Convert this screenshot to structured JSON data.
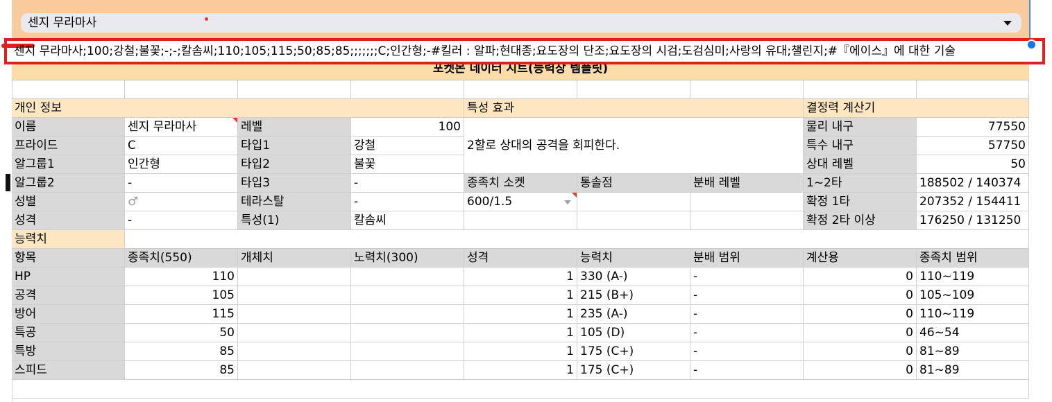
{
  "dropdown": {
    "value": "센지 무라마사"
  },
  "formula_cell": {
    "text": "센지 무라마사;100;강철;불꽃;-;-;칼솜씨;110;105;115;50;85;85;;;;;;;C;인간형;-#킬러 : 알파;현대종;요도장의 단조;요도장의 시검;도검심미;사랑의 유대;챌린지;#『에이스』에 대한 기술"
  },
  "title": "포켓몬 데이터 시트(능력창 템플릿)",
  "sections": {
    "personal": "개인 정보",
    "trait": "특성 효과",
    "calc": "결정력 계산기",
    "stats": "능력치"
  },
  "personal": {
    "name_label": "이름",
    "name": "센지 무라마사",
    "level_label": "레벨",
    "level": "100",
    "pride_label": "프라이드",
    "pride": "C",
    "type1_label": "타입1",
    "type1": "강철",
    "egg1_label": "알그룹1",
    "egg1": "인간형",
    "type2_label": "타입2",
    "type2": "불꽃",
    "egg2_label": "알그룹2",
    "egg2": "-",
    "type3_label": "타입3",
    "type3": "-",
    "gender_label": "성별",
    "gender": "♂",
    "tera_label": "테라스탈",
    "tera": "-",
    "nature_label": "성격",
    "nature": "-",
    "ability_label": "특성(1)",
    "ability": "칼솜씨"
  },
  "trait_effect": "2할로 상대의 공격을 회피한다.",
  "socket": {
    "socket_label": "종족치 소켓",
    "socket_value": "600/1.5",
    "command_label": "통솔점",
    "dist_level_label": "분배 레벨"
  },
  "calc": {
    "phys_label": "물리 내구",
    "phys": "77550",
    "spec_label": "특수 내구",
    "spec": "57750",
    "opp_level_label": "상대 레벨",
    "opp_level": "50",
    "hit12_label": "1~2타",
    "hit12": "188502 / 140374",
    "ko1_label": "확정 1타",
    "ko1": "207352 / 154411",
    "ko2_label": "확정 2타 이상",
    "ko2": "176250 / 131250"
  },
  "stats_headers": [
    "항목",
    "종족치(550)",
    "개체치",
    "노력치(300)",
    "성격",
    "능력치",
    "분배 범위",
    "계산용",
    "종족치 범위"
  ],
  "stats_rows": [
    {
      "name": "HP",
      "base": "110",
      "iv": "",
      "ev": "",
      "nature": "1",
      "stat": "330 (A-)",
      "dist": "-",
      "calc": "0",
      "range": "110~119"
    },
    {
      "name": "공격",
      "base": "105",
      "iv": "",
      "ev": "",
      "nature": "1",
      "stat": "215 (B+)",
      "dist": "-",
      "calc": "0",
      "range": "105~109"
    },
    {
      "name": "방어",
      "base": "115",
      "iv": "",
      "ev": "",
      "nature": "1",
      "stat": "235 (A-)",
      "dist": "-",
      "calc": "0",
      "range": "110~119"
    },
    {
      "name": "특공",
      "base": "50",
      "iv": "",
      "ev": "",
      "nature": "1",
      "stat": "105 (D)",
      "dist": "-",
      "calc": "0",
      "range": "46~54"
    },
    {
      "name": "특방",
      "base": "85",
      "iv": "",
      "ev": "",
      "nature": "1",
      "stat": "175 (C+)",
      "dist": "-",
      "calc": "0",
      "range": "81~89"
    },
    {
      "name": "스피드",
      "base": "85",
      "iv": "",
      "ev": "",
      "nature": "1",
      "stat": "175 (C+)",
      "dist": "-",
      "calc": "0",
      "range": "81~89"
    }
  ]
}
